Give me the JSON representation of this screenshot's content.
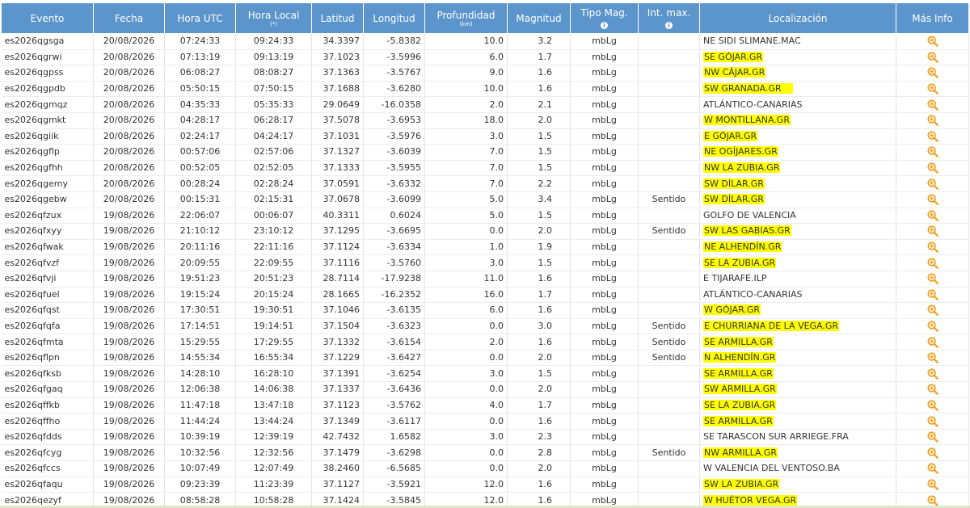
{
  "table": {
    "headers": {
      "evento": "Evento",
      "fecha": "Fecha",
      "hora_utc": "Hora UTC",
      "hora_local": "Hora Local",
      "hora_local_sub": "(*)",
      "latitud": "Latitud",
      "longitud": "Longitud",
      "profundidad": "Profundidad",
      "profundidad_sub": "(km)",
      "magnitud": "Magnitud",
      "tipo_mag": "Tipo Mag.",
      "int_max": "Int. max.",
      "localizacion": "Localización",
      "mas_info": "Más Info"
    },
    "info_icon_glyph": "i",
    "rows": [
      {
        "evento": "es2026qgsga",
        "fecha": "20/08/2026",
        "hora_utc": "07:24:33",
        "hora_local": "09:24:33",
        "latitud": "34.3397",
        "longitud": "-5.8382",
        "profundidad": "10.0",
        "magnitud": "3.2",
        "tipo_mag": "mbLg",
        "int_max": "",
        "localizacion": "NE SIDI SLIMANE.MAC",
        "highlighted": false
      },
      {
        "evento": "es2026qgrwi",
        "fecha": "20/08/2026",
        "hora_utc": "07:13:19",
        "hora_local": "09:13:19",
        "latitud": "37.1023",
        "longitud": "-3.5996",
        "profundidad": "6.0",
        "magnitud": "1.7",
        "tipo_mag": "mbLg",
        "int_max": "",
        "localizacion": "SE GÓJAR.GR",
        "highlighted": true
      },
      {
        "evento": "es2026qgpss",
        "fecha": "20/08/2026",
        "hora_utc": "06:08:27",
        "hora_local": "08:08:27",
        "latitud": "37.1363",
        "longitud": "-3.5767",
        "profundidad": "9.0",
        "magnitud": "1.6",
        "tipo_mag": "mbLg",
        "int_max": "",
        "localizacion": "NW CÁJAR.GR",
        "highlighted": true
      },
      {
        "evento": "es2026qgpdb",
        "fecha": "20/08/2026",
        "hora_utc": "05:50:15",
        "hora_local": "07:50:15",
        "latitud": "37.1688",
        "longitud": "-3.6280",
        "profundidad": "10.0",
        "magnitud": "1.6",
        "tipo_mag": "mbLg",
        "int_max": "",
        "localizacion": "SW GRANADA.GR",
        "highlighted": true,
        "long_mark": true
      },
      {
        "evento": "es2026qgmqz",
        "fecha": "20/08/2026",
        "hora_utc": "04:35:33",
        "hora_local": "05:35:33",
        "latitud": "29.0649",
        "longitud": "-16.0358",
        "profundidad": "2.0",
        "magnitud": "2.1",
        "tipo_mag": "mbLg",
        "int_max": "",
        "localizacion": "ATLÁNTICO-CANARIAS",
        "highlighted": false
      },
      {
        "evento": "es2026qgmkt",
        "fecha": "20/08/2026",
        "hora_utc": "04:28:17",
        "hora_local": "06:28:17",
        "latitud": "37.5078",
        "longitud": "-3.6953",
        "profundidad": "18.0",
        "magnitud": "2.0",
        "tipo_mag": "mbLg",
        "int_max": "",
        "localizacion": "W MONTILLANA.GR",
        "highlighted": true
      },
      {
        "evento": "es2026qgiik",
        "fecha": "20/08/2026",
        "hora_utc": "02:24:17",
        "hora_local": "04:24:17",
        "latitud": "37.1031",
        "longitud": "-3.5976",
        "profundidad": "3.0",
        "magnitud": "1.5",
        "tipo_mag": "mbLg",
        "int_max": "",
        "localizacion": "E GÓJAR.GR",
        "highlighted": true
      },
      {
        "evento": "es2026qgflp",
        "fecha": "20/08/2026",
        "hora_utc": "00:57:06",
        "hora_local": "02:57:06",
        "latitud": "37.1327",
        "longitud": "-3.6039",
        "profundidad": "7.0",
        "magnitud": "1.5",
        "tipo_mag": "mbLg",
        "int_max": "",
        "localizacion": "NE OGÍJARES.GR",
        "highlighted": true
      },
      {
        "evento": "es2026qgfhh",
        "fecha": "20/08/2026",
        "hora_utc": "00:52:05",
        "hora_local": "02:52:05",
        "latitud": "37.1333",
        "longitud": "-3.5955",
        "profundidad": "7.0",
        "magnitud": "1.5",
        "tipo_mag": "mbLg",
        "int_max": "",
        "localizacion": "NW LA ZUBIA.GR",
        "highlighted": true
      },
      {
        "evento": "es2026qgemy",
        "fecha": "20/08/2026",
        "hora_utc": "00:28:24",
        "hora_local": "02:28:24",
        "latitud": "37.0591",
        "longitud": "-3.6332",
        "profundidad": "7.0",
        "magnitud": "2.2",
        "tipo_mag": "mbLg",
        "int_max": "",
        "localizacion": "SW DÍLAR.GR",
        "highlighted": true
      },
      {
        "evento": "es2026qgebw",
        "fecha": "20/08/2026",
        "hora_utc": "00:15:31",
        "hora_local": "02:15:31",
        "latitud": "37.0678",
        "longitud": "-3.6099",
        "profundidad": "5.0",
        "magnitud": "3.4",
        "tipo_mag": "mbLg",
        "int_max": "Sentido",
        "localizacion": "SW DÍLAR.GR",
        "highlighted": true
      },
      {
        "evento": "es2026qfzux",
        "fecha": "19/08/2026",
        "hora_utc": "22:06:07",
        "hora_local": "00:06:07",
        "latitud": "40.3311",
        "longitud": "0.6024",
        "profundidad": "5.0",
        "magnitud": "1.5",
        "tipo_mag": "mbLg",
        "int_max": "",
        "localizacion": "GOLFO DE VALENCIA",
        "highlighted": false
      },
      {
        "evento": "es2026qfxyy",
        "fecha": "19/08/2026",
        "hora_utc": "21:10:12",
        "hora_local": "23:10:12",
        "latitud": "37.1295",
        "longitud": "-3.6695",
        "profundidad": "0.0",
        "magnitud": "2.0",
        "tipo_mag": "mbLg",
        "int_max": "Sentido",
        "localizacion": "SW LAS GABIAS.GR",
        "highlighted": true
      },
      {
        "evento": "es2026qfwak",
        "fecha": "19/08/2026",
        "hora_utc": "20:11:16",
        "hora_local": "22:11:16",
        "latitud": "37.1124",
        "longitud": "-3.6334",
        "profundidad": "1.0",
        "magnitud": "1.9",
        "tipo_mag": "mbLg",
        "int_max": "",
        "localizacion": "NE ALHENDÍN.GR",
        "highlighted": true
      },
      {
        "evento": "es2026qfvzf",
        "fecha": "19/08/2026",
        "hora_utc": "20:09:55",
        "hora_local": "22:09:55",
        "latitud": "37.1116",
        "longitud": "-3.5760",
        "profundidad": "3.0",
        "magnitud": "1.5",
        "tipo_mag": "mbLg",
        "int_max": "",
        "localizacion": "SE LA ZUBIA.GR",
        "highlighted": true
      },
      {
        "evento": "es2026qfvji",
        "fecha": "19/08/2026",
        "hora_utc": "19:51:23",
        "hora_local": "20:51:23",
        "latitud": "28.7114",
        "longitud": "-17.9238",
        "profundidad": "11.0",
        "magnitud": "1.6",
        "tipo_mag": "mbLg",
        "int_max": "",
        "localizacion": "E TIJARAFE.ILP",
        "highlighted": false
      },
      {
        "evento": "es2026qfuel",
        "fecha": "19/08/2026",
        "hora_utc": "19:15:24",
        "hora_local": "20:15:24",
        "latitud": "28.1665",
        "longitud": "-16.2352",
        "profundidad": "16.0",
        "magnitud": "1.7",
        "tipo_mag": "mbLg",
        "int_max": "",
        "localizacion": "ATLÁNTICO-CANARIAS",
        "highlighted": false
      },
      {
        "evento": "es2026qfqst",
        "fecha": "19/08/2026",
        "hora_utc": "17:30:51",
        "hora_local": "19:30:51",
        "latitud": "37.1046",
        "longitud": "-3.6135",
        "profundidad": "6.0",
        "magnitud": "1.6",
        "tipo_mag": "mbLg",
        "int_max": "",
        "localizacion": "W GÓJAR.GR",
        "highlighted": true
      },
      {
        "evento": "es2026qfqfa",
        "fecha": "19/08/2026",
        "hora_utc": "17:14:51",
        "hora_local": "19:14:51",
        "latitud": "37.1504",
        "longitud": "-3.6323",
        "profundidad": "0.0",
        "magnitud": "3.0",
        "tipo_mag": "mbLg",
        "int_max": "Sentido",
        "localizacion": "E CHURRIANA DE LA VEGA.GR",
        "highlighted": true
      },
      {
        "evento": "es2026qfmta",
        "fecha": "19/08/2026",
        "hora_utc": "15:29:55",
        "hora_local": "17:29:55",
        "latitud": "37.1332",
        "longitud": "-3.6154",
        "profundidad": "2.0",
        "magnitud": "1.6",
        "tipo_mag": "mbLg",
        "int_max": "Sentido",
        "localizacion": "SE ARMILLA.GR",
        "highlighted": true
      },
      {
        "evento": "es2026qflpn",
        "fecha": "19/08/2026",
        "hora_utc": "14:55:34",
        "hora_local": "16:55:34",
        "latitud": "37.1229",
        "longitud": "-3.6427",
        "profundidad": "0.0",
        "magnitud": "2.0",
        "tipo_mag": "mbLg",
        "int_max": "Sentido",
        "localizacion": "N ALHENDÍN.GR",
        "highlighted": true
      },
      {
        "evento": "es2026qfksb",
        "fecha": "19/08/2026",
        "hora_utc": "14:28:10",
        "hora_local": "16:28:10",
        "latitud": "37.1391",
        "longitud": "-3.6254",
        "profundidad": "3.0",
        "magnitud": "1.5",
        "tipo_mag": "mbLg",
        "int_max": "",
        "localizacion": "SE ARMILLA.GR",
        "highlighted": true
      },
      {
        "evento": "es2026qfgaq",
        "fecha": "19/08/2026",
        "hora_utc": "12:06:38",
        "hora_local": "14:06:38",
        "latitud": "37.1337",
        "longitud": "-3.6436",
        "profundidad": "0.0",
        "magnitud": "2.0",
        "tipo_mag": "mbLg",
        "int_max": "",
        "localizacion": "SW ARMILLA.GR",
        "highlighted": true
      },
      {
        "evento": "es2026qffkb",
        "fecha": "19/08/2026",
        "hora_utc": "11:47:18",
        "hora_local": "13:47:18",
        "latitud": "37.1123",
        "longitud": "-3.5762",
        "profundidad": "4.0",
        "magnitud": "1.7",
        "tipo_mag": "mbLg",
        "int_max": "",
        "localizacion": "SE LA ZUBIA.GR",
        "highlighted": true
      },
      {
        "evento": "es2026qffho",
        "fecha": "19/08/2026",
        "hora_utc": "11:44:24",
        "hora_local": "13:44:24",
        "latitud": "37.1349",
        "longitud": "-3.6117",
        "profundidad": "0.0",
        "magnitud": "1.6",
        "tipo_mag": "mbLg",
        "int_max": "",
        "localizacion": "SE ARMILLA.GR",
        "highlighted": true
      },
      {
        "evento": "es2026qfdds",
        "fecha": "19/08/2026",
        "hora_utc": "10:39:19",
        "hora_local": "12:39:19",
        "latitud": "42.7432",
        "longitud": "1.6582",
        "profundidad": "3.0",
        "magnitud": "2.3",
        "tipo_mag": "mbLg",
        "int_max": "",
        "localizacion": "SE TARASCON SUR ARRIEGE.FRA",
        "highlighted": false
      },
      {
        "evento": "es2026qfcyg",
        "fecha": "19/08/2026",
        "hora_utc": "10:32:56",
        "hora_local": "12:32:56",
        "latitud": "37.1479",
        "longitud": "-3.6298",
        "profundidad": "0.0",
        "magnitud": "2.8",
        "tipo_mag": "mbLg",
        "int_max": "Sentido",
        "localizacion": "NW ARMILLA.GR",
        "highlighted": true
      },
      {
        "evento": "es2026qfccs",
        "fecha": "19/08/2026",
        "hora_utc": "10:07:49",
        "hora_local": "12:07:49",
        "latitud": "38.2460",
        "longitud": "-6.5685",
        "profundidad": "0.0",
        "magnitud": "2.0",
        "tipo_mag": "mbLg",
        "int_max": "",
        "localizacion": "W VALENCIA DEL VENTOSO.BA",
        "highlighted": false
      },
      {
        "evento": "es2026qfaqu",
        "fecha": "19/08/2026",
        "hora_utc": "09:23:39",
        "hora_local": "11:23:39",
        "latitud": "37.1127",
        "longitud": "-3.5921",
        "profundidad": "12.0",
        "magnitud": "1.6",
        "tipo_mag": "mbLg",
        "int_max": "",
        "localizacion": "SW LA ZUBIA.GR",
        "highlighted": true
      },
      {
        "evento": "es2026qezyf",
        "fecha": "19/08/2026",
        "hora_utc": "08:58:28",
        "hora_local": "10:58:28",
        "latitud": "37.1424",
        "longitud": "-3.5845",
        "profundidad": "12.0",
        "magnitud": "1.6",
        "tipo_mag": "mbLg",
        "int_max": "",
        "localizacion": "W HUÉTOR VEGA.GR",
        "highlighted": true
      }
    ]
  },
  "colors": {
    "header_bg": "#5b95cc",
    "header_text": "#ffffff",
    "highlight": "#ffff00",
    "zoom_icon": "#f0a020",
    "text": "#333333"
  },
  "icons": {
    "more_info": "zoom-in-icon",
    "header_info": "info-icon"
  }
}
